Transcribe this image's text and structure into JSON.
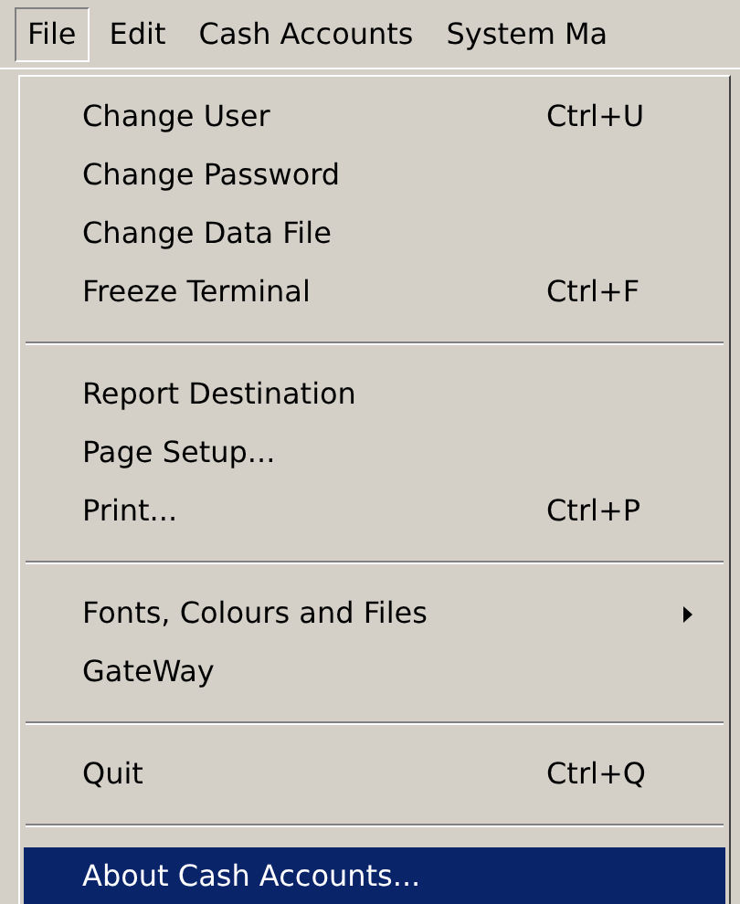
{
  "menubar": [
    {
      "label": "File",
      "selected": true
    },
    {
      "label": "Edit",
      "selected": false
    },
    {
      "label": "Cash Accounts",
      "selected": false
    },
    {
      "label": "System Ma",
      "selected": false
    }
  ],
  "menu": {
    "groups": [
      [
        {
          "label": "Change User",
          "shortcut": "Ctrl+U",
          "selected": false
        },
        {
          "label": "Change Password",
          "selected": false
        },
        {
          "label": "Change Data File",
          "selected": false
        },
        {
          "label": "Freeze Terminal",
          "shortcut": "Ctrl+F",
          "selected": false
        }
      ],
      [
        {
          "label": "Report Destination",
          "selected": false
        },
        {
          "label": "Page Setup...",
          "selected": false
        },
        {
          "label": "Print...",
          "shortcut": "Ctrl+P",
          "selected": false
        }
      ],
      [
        {
          "label": "Fonts, Colours and Files",
          "submenu": true,
          "selected": false
        },
        {
          "label": "GateWay",
          "selected": false
        }
      ],
      [
        {
          "label": "Quit",
          "shortcut": "Ctrl+Q",
          "selected": false
        }
      ],
      [
        {
          "label": "About Cash Accounts...",
          "selected": true
        }
      ]
    ]
  }
}
